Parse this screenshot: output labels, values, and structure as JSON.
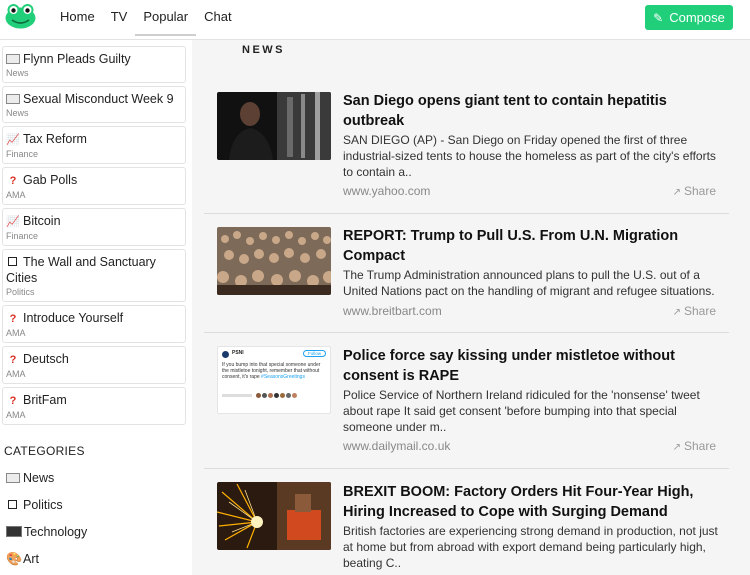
{
  "nav": {
    "home": "Home",
    "tv": "TV",
    "popular": "Popular",
    "chat": "Chat",
    "compose": "Compose"
  },
  "topics": [
    {
      "title": "Flynn Pleads Guilty",
      "sub": "News",
      "icon": "newspaper-icon"
    },
    {
      "title": "Sexual Misconduct Week 9",
      "sub": "News",
      "icon": "newspaper-icon"
    },
    {
      "title": "Tax Reform",
      "sub": "Finance",
      "icon": "chart-icon"
    },
    {
      "title": "Gab Polls",
      "sub": "AMA",
      "icon": "question-icon"
    },
    {
      "title": "Bitcoin",
      "sub": "Finance",
      "icon": "chart-icon"
    },
    {
      "title": "The Wall and Sanctuary Cities",
      "sub": "Politics",
      "icon": "box-icon"
    },
    {
      "title": "Introduce Yourself",
      "sub": "AMA",
      "icon": "question-icon"
    },
    {
      "title": "Deutsch",
      "sub": "AMA",
      "icon": "question-icon"
    },
    {
      "title": "BritFam",
      "sub": "AMA",
      "icon": "question-icon"
    }
  ],
  "categories": {
    "heading": "CATEGORIES",
    "items": [
      "News",
      "Politics",
      "Technology",
      "Art"
    ]
  },
  "news": {
    "heading": "NEWS",
    "share_label": "Share",
    "items": [
      {
        "title": "San Diego opens giant tent to contain hepatitis outbreak",
        "desc": "SAN DIEGO (AP) - San Diego on Friday opened the first of three industrial-sized tents to house the homeless as part of the city's efforts to contain a..",
        "domain": "www.yahoo.com"
      },
      {
        "title": "REPORT: Trump to Pull U.S. From U.N. Migration Compact",
        "desc": "The Trump Administration announced plans to pull the U.S. out of a United Nations pact on the handling of migrant and refugee situations.",
        "domain": "www.breitbart.com"
      },
      {
        "title": "Police force say kissing under mistletoe without consent is RAPE",
        "desc": "Police Service of Northern Ireland ridiculed for the 'nonsense' tweet about rape It said get consent 'before bumping into that special someone under m..",
        "domain": "www.dailymail.co.uk"
      },
      {
        "title": "BREXIT BOOM: Factory Orders Hit Four-Year High, Hiring Increased to Cope with Surging Demand",
        "desc": "British factories are experiencing strong demand in production, not just at home but from abroad with export demand being particularly high, beating C..",
        "domain": ""
      }
    ]
  },
  "tweet_thumb": {
    "handle": "PSNI",
    "body": "If you bump into that special someone under the mistletoe tonight, remember that without consent, it's rape",
    "hashtag": "#SeasonsGreetings",
    "follow": "Follow"
  }
}
